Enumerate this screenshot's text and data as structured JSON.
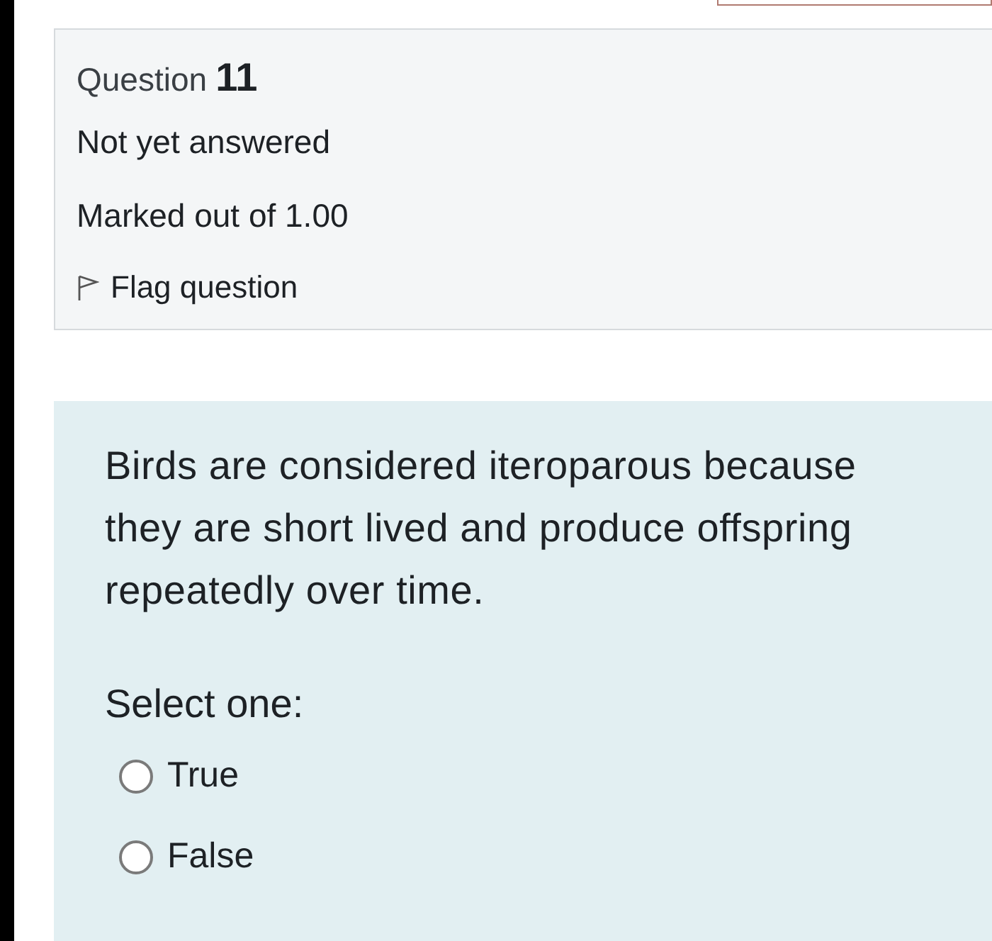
{
  "question": {
    "label": "Question",
    "number": "11",
    "status": "Not yet answered",
    "marks": "Marked out of 1.00",
    "flag": {
      "label": "Flag question",
      "flagged": false
    }
  },
  "prompt": "Birds are considered iteroparous because they are short lived and produce offspring repeatedly over time.",
  "select_label": "Select one:",
  "options": [
    {
      "label": "True",
      "selected": false
    },
    {
      "label": "False",
      "selected": false
    }
  ]
}
